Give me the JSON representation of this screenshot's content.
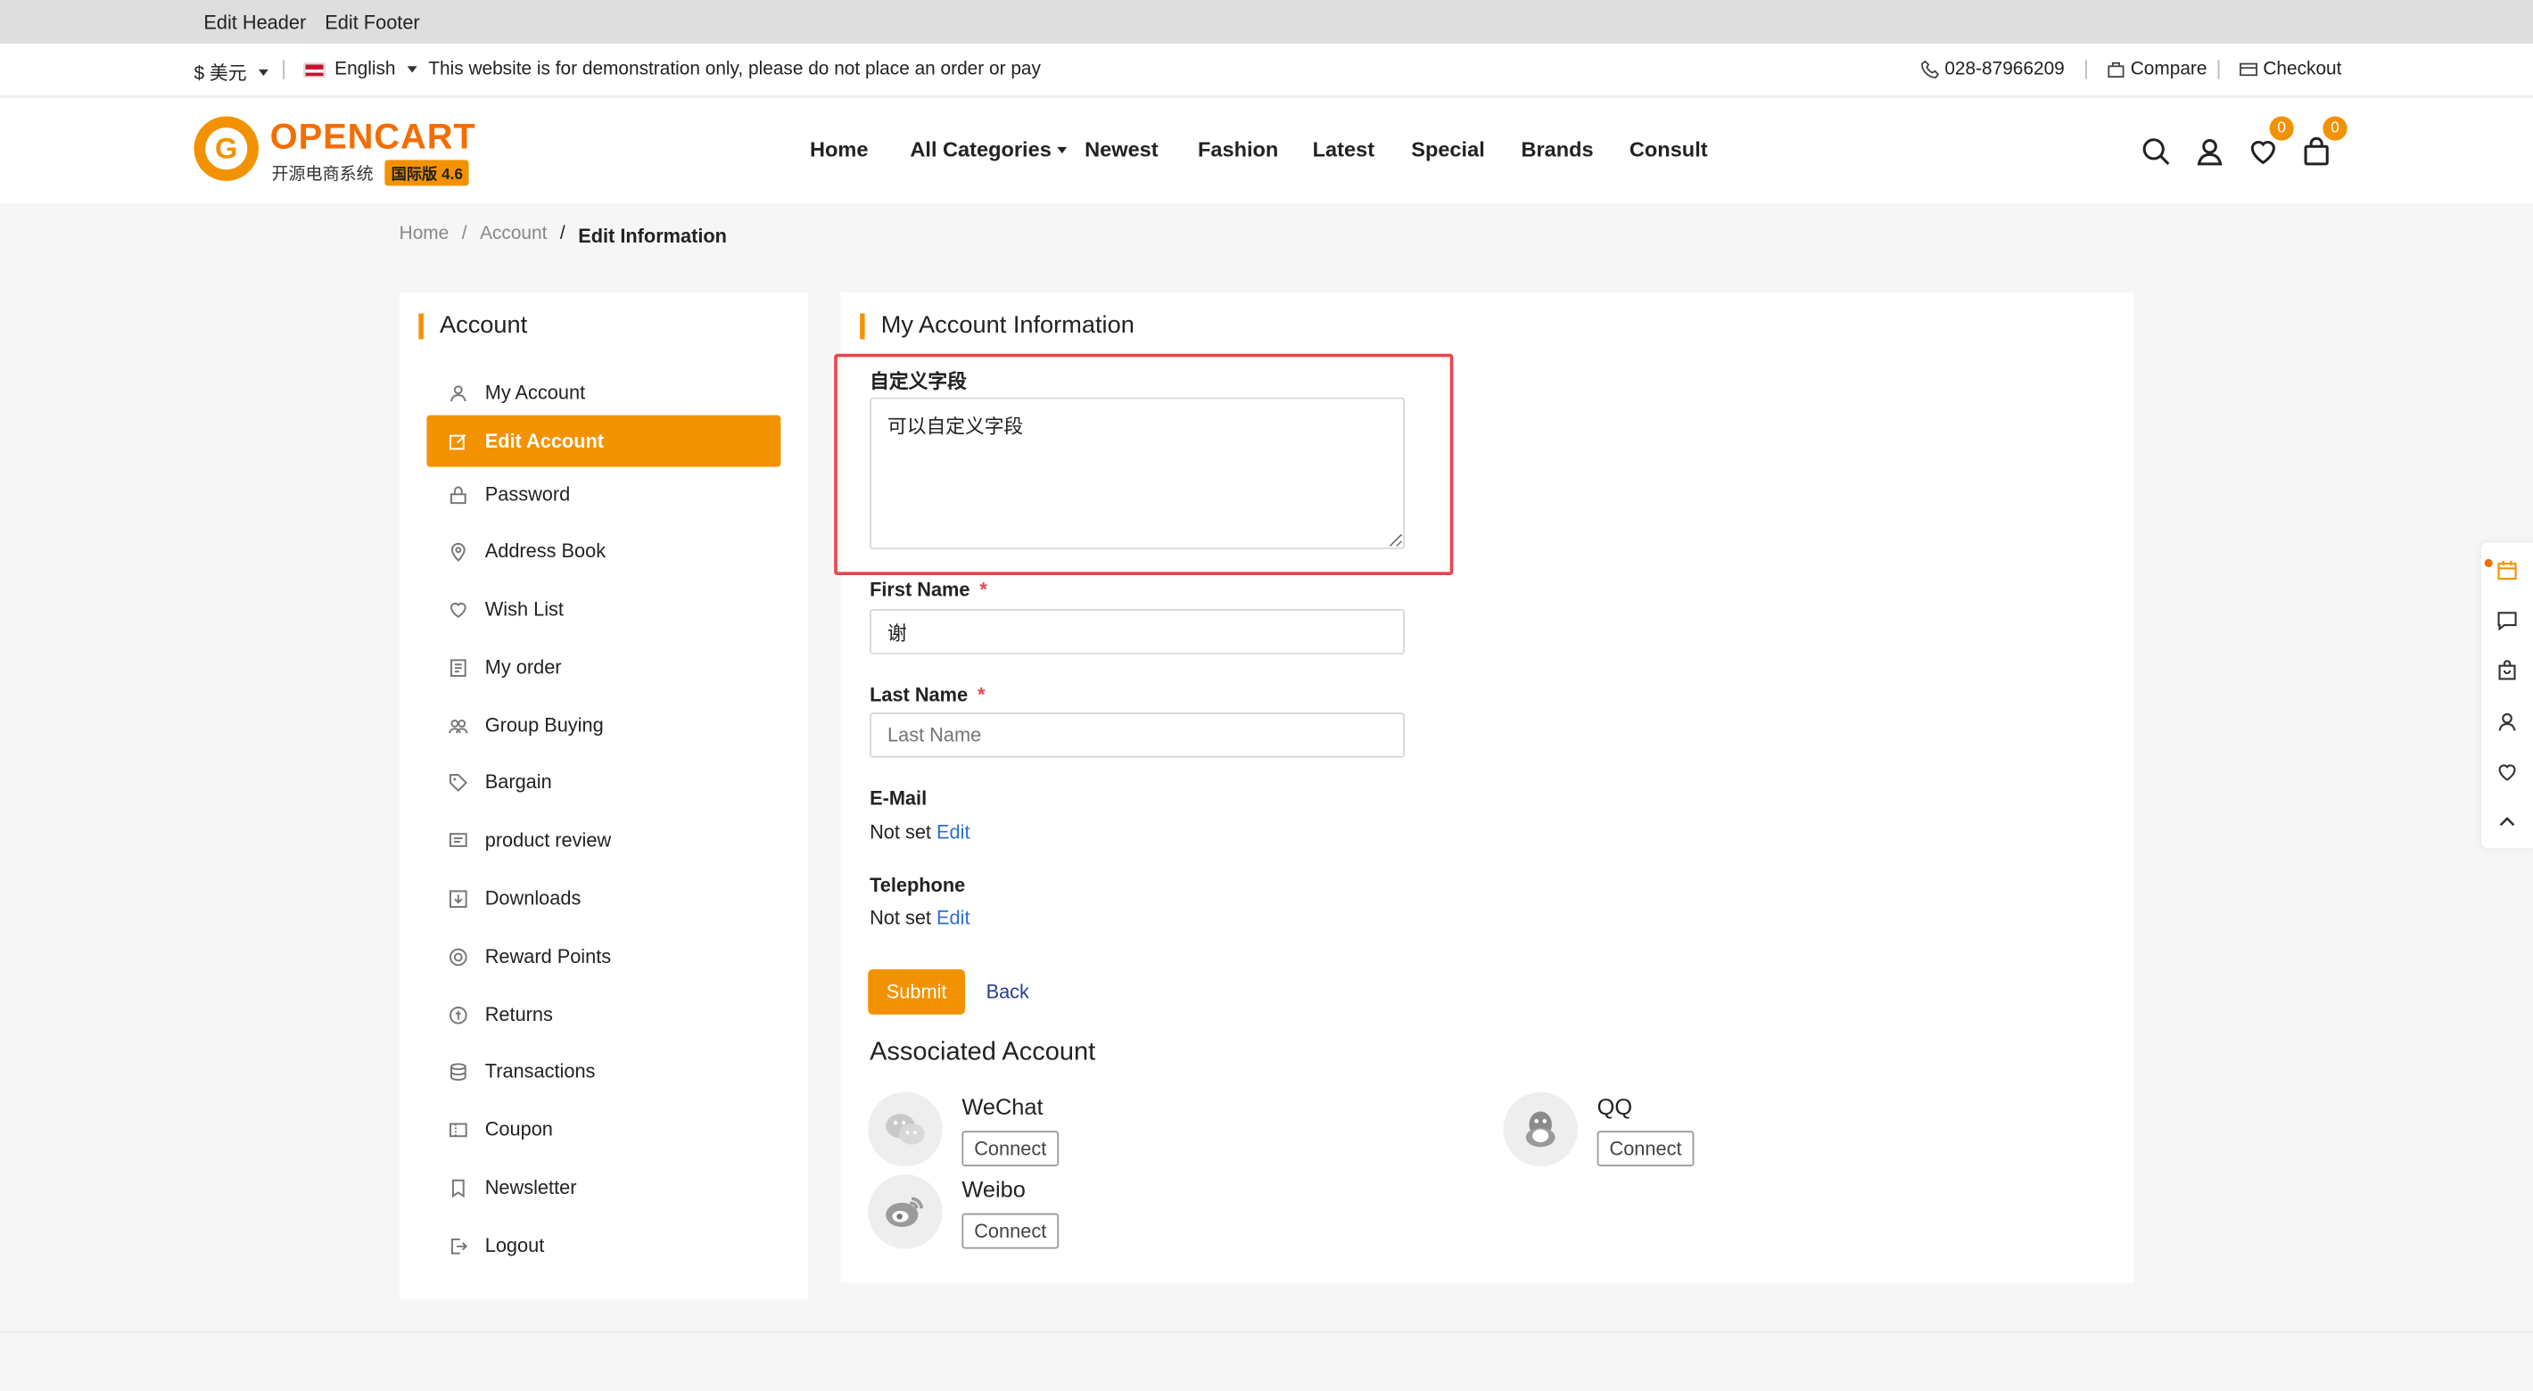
{
  "admin_bar": {
    "edit_header": "Edit Header",
    "edit_footer": "Edit Footer"
  },
  "top_bar": {
    "currency": "$ 美元",
    "language": "English",
    "notice": "This website is for demonstration only, please do not place an order or pay",
    "phone": "028-87966209",
    "compare": "Compare",
    "checkout": "Checkout"
  },
  "logo": {
    "text": "OPENCART",
    "subtitle": "开源电商系统",
    "badge": "国际版 4.6",
    "letter": "G"
  },
  "nav": [
    "Home",
    "All Categories",
    "Newest",
    "Fashion",
    "Latest",
    "Special",
    "Brands",
    "Consult"
  ],
  "header_icons": {
    "wishlist_count": "0",
    "cart_count": "0"
  },
  "breadcrumb": {
    "home": "Home",
    "account": "Account",
    "current": "Edit Information",
    "sep": "/"
  },
  "sidebar": {
    "title": "Account",
    "items": [
      {
        "label": "My Account",
        "icon": "user-icon"
      },
      {
        "label": "Edit Account",
        "icon": "edit-icon",
        "active": true
      },
      {
        "label": "Password",
        "icon": "lock-icon"
      },
      {
        "label": "Address Book",
        "icon": "location-icon"
      },
      {
        "label": "Wish List",
        "icon": "heart-icon"
      },
      {
        "label": "My order",
        "icon": "order-icon"
      },
      {
        "label": "Group Buying",
        "icon": "group-icon"
      },
      {
        "label": "Bargain",
        "icon": "tag-icon"
      },
      {
        "label": "product review",
        "icon": "review-icon"
      },
      {
        "label": "Downloads",
        "icon": "download-icon"
      },
      {
        "label": "Reward Points",
        "icon": "reward-icon"
      },
      {
        "label": "Returns",
        "icon": "returns-icon"
      },
      {
        "label": "Transactions",
        "icon": "transactions-icon"
      },
      {
        "label": "Coupon",
        "icon": "coupon-icon"
      },
      {
        "label": "Newsletter",
        "icon": "newsletter-icon"
      },
      {
        "label": "Logout",
        "icon": "logout-icon"
      }
    ]
  },
  "form": {
    "title": "My Account Information",
    "custom_field_label": "自定义字段",
    "custom_field_value": "可以自定义字段",
    "first_name_label": "First Name",
    "first_name_value": "谢",
    "last_name_label": "Last Name",
    "last_name_placeholder": "Last Name",
    "required_mark": "*",
    "email_label": "E-Mail",
    "email_value": "Not set",
    "telephone_label": "Telephone",
    "telephone_value": "Not set",
    "edit_link": "Edit",
    "submit": "Submit",
    "back": "Back"
  },
  "associated": {
    "title": "Associated Account",
    "accounts": [
      {
        "name": "WeChat",
        "button": "Connect",
        "icon": "wechat-icon"
      },
      {
        "name": "QQ",
        "button": "Connect",
        "icon": "qq-icon"
      },
      {
        "name": "Weibo",
        "button": "Connect",
        "icon": "weibo-icon"
      }
    ]
  },
  "colors": {
    "accent": "#f39200",
    "highlight_border": "#e8454f",
    "link": "#2a6fd1"
  }
}
